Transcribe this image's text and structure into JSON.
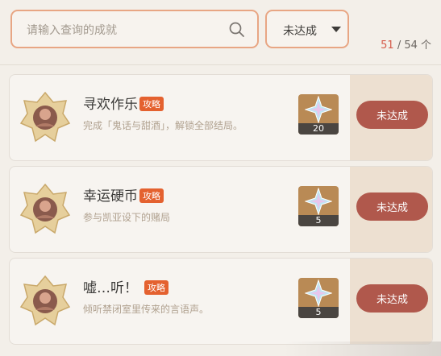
{
  "search": {
    "placeholder": "请输入查询的成就",
    "icon": "search-icon"
  },
  "filter": {
    "selected": "未达成",
    "icon": "caret-down-icon"
  },
  "counter": {
    "done": "51",
    "rest": "/ 54 个"
  },
  "colors": {
    "accent_border": "#e8a684",
    "status_button": "#b0584c",
    "tag": "#e4612f",
    "count": "#d55a49"
  },
  "achievements": [
    {
      "title": "寻欢作乐",
      "tag": "攻略",
      "desc": "完成「鬼话与甜酒」，解锁全部结局。",
      "reward": "20",
      "status": "未达成"
    },
    {
      "title": "幸运硬币",
      "tag": "攻略",
      "desc": "参与凯亚设下的赌局",
      "reward": "5",
      "status": "未达成"
    },
    {
      "title": "嘘…听！",
      "tag": "攻略",
      "desc": "倾听禁闭室里传来的言语声。",
      "reward": "5",
      "status": "未达成"
    }
  ]
}
